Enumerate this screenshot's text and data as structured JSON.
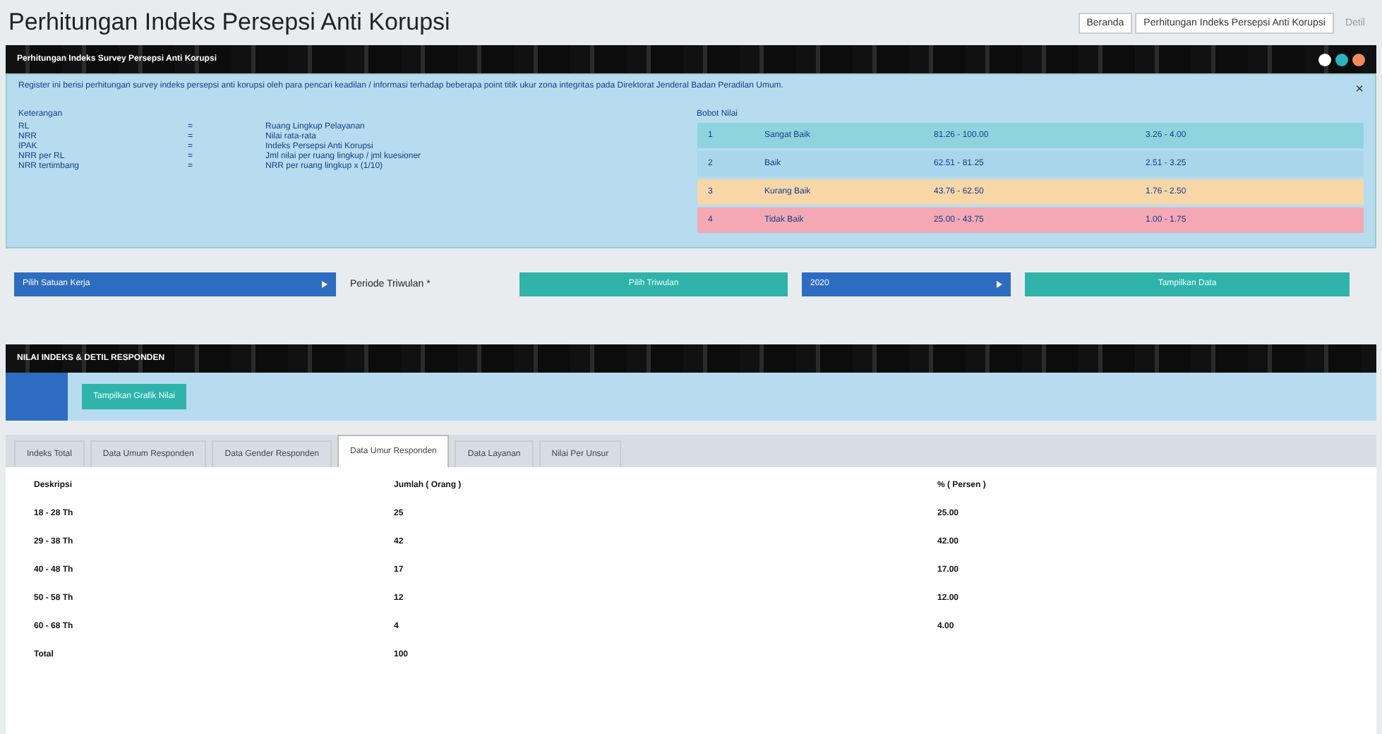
{
  "page_title": "Perhitungan Indeks Persepsi Anti Korupsi",
  "breadcrumb": [
    {
      "label": "Beranda",
      "selected": false
    },
    {
      "label": "Perhitungan Indeks Persepsi Anti Korupsi",
      "selected": false
    },
    {
      "label": "Detil",
      "selected": true
    }
  ],
  "panel": {
    "title": "Perhitungan Indeks Survey Persepsi Anti Korupsi",
    "close": "×",
    "intro": "Register ini berisi perhitungan survey indeks persepsi anti korupsi oleh para pencari keadilan / informasi terhadap beberapa point titik ukur zona integritas pada Direktorat Jenderal Badan Peradilan Umum.",
    "legend_heading": "Keterangan",
    "legend": [
      {
        "term": "RL",
        "sep": "=",
        "meaning": "Ruang Lingkup Pelayanan"
      },
      {
        "term": "NRR",
        "sep": "=",
        "meaning": "Nilai rata-rata"
      },
      {
        "term": "IPAK",
        "sep": "=",
        "meaning": "Indeks Persepsi Anti Korupsi"
      },
      {
        "term": "NRR per RL",
        "sep": "=",
        "meaning": "Jml nilai per ruang lingkup / jml kuesioner"
      },
      {
        "term": "NRR tertimbang",
        "sep": "=",
        "meaning": "NRR per ruang lingkup x (1/10)"
      }
    ],
    "weights_heading": "Bobot Nilai",
    "weights": [
      {
        "no": "1",
        "label": "Sangat Baik",
        "range": "81.26 - 100.00",
        "score": "3.26 - 4.00",
        "color": "#8fd3df"
      },
      {
        "no": "2",
        "label": "Baik",
        "range": "62.51 - 81.25",
        "score": "2.51 - 3.25",
        "color": "#a9d6ea"
      },
      {
        "no": "3",
        "label": "Kurang Baik",
        "range": "43.76 - 62.50",
        "score": "1.76 - 2.50",
        "color": "#f7d6a8"
      },
      {
        "no": "4",
        "label": "Tidak Baik",
        "range": "25.00 - 43.75",
        "score": "1.00 - 1.75",
        "color": "#f4a8b4"
      }
    ]
  },
  "filters": {
    "unit": "Pilih Satuan Kerja",
    "period_label": "Periode Triwulan *",
    "quarter": "Pilih Triwulan",
    "year": "2020",
    "submit": "Tampilkan Data"
  },
  "section": {
    "title": "NILAI INDEKS & DETIL RESPONDEN",
    "chart_button": "Tampilkan Grafik Nilai"
  },
  "tabs": [
    {
      "label": "Indeks Total",
      "selected": false
    },
    {
      "label": "Data Umum Responden",
      "selected": false
    },
    {
      "label": "Data Gender Responden",
      "selected": false
    },
    {
      "label": "Data Umur Responden",
      "selected": true
    },
    {
      "label": "Data Layanan",
      "selected": false
    },
    {
      "label": "Nilai Per Unsur",
      "selected": false
    }
  ],
  "table": {
    "columns": [
      "Deskripsi",
      "Jumlah ( Orang )",
      "% ( Persen )"
    ],
    "rows": [
      [
        "18 - 28 Th",
        "25",
        "25.00"
      ],
      [
        "29 - 38 Th",
        "42",
        "42.00"
      ],
      [
        "40 - 48 Th",
        "17",
        "17.00"
      ],
      [
        "50 - 58 Th",
        "12",
        "12.00"
      ],
      [
        "60 - 68 Th",
        "4",
        "4.00"
      ],
      [
        "Total",
        "100",
        ""
      ]
    ]
  }
}
